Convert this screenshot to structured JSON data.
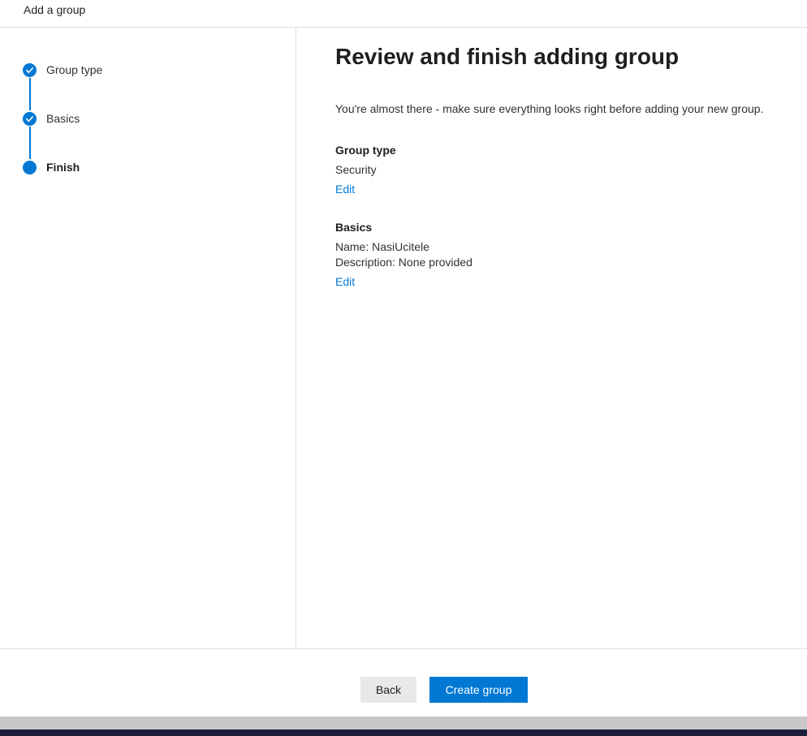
{
  "header": {
    "title": "Add a group"
  },
  "steps": [
    {
      "label": "Group type",
      "state": "completed",
      "icon": "checkmark-icon"
    },
    {
      "label": "Basics",
      "state": "completed",
      "icon": "checkmark-icon"
    },
    {
      "label": "Finish",
      "state": "current",
      "icon": "filled-circle-icon"
    }
  ],
  "main": {
    "title": "Review and finish adding group",
    "intro": "You're almost there - make sure everything looks right before adding your new group.",
    "group_type": {
      "heading": "Group type",
      "value": "Security",
      "edit_label": "Edit"
    },
    "basics": {
      "heading": "Basics",
      "name_line": "Name: NasiUcitele",
      "description_line": "Description: None provided",
      "edit_label": "Edit"
    }
  },
  "footer": {
    "back_label": "Back",
    "create_label": "Create group"
  },
  "colors": {
    "accent": "#0078d4",
    "secondary_button": "#e8e8e8",
    "taskbar": "#1b1f3a"
  }
}
